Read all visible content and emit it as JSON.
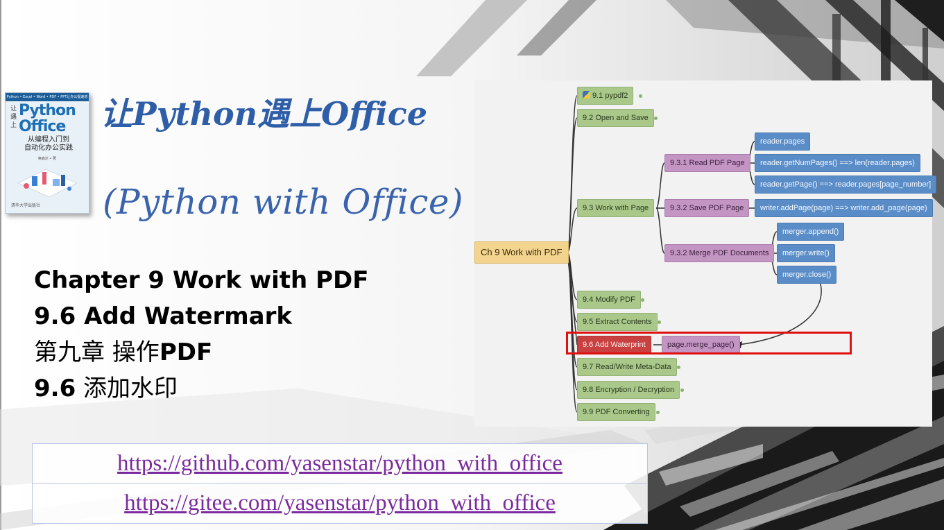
{
  "book": {
    "strip": "Python • Excel • Word • PDF • PPT让办公提速增效",
    "rang_yu_shang": "让 遇 上",
    "title_line1": "Python",
    "title_line2": "Office",
    "subtitle_line1": "从编程入门到",
    "subtitle_line2": "自动化办公实践",
    "author": "奥森达 • 著",
    "publisher": "清华大学出版社"
  },
  "title": {
    "chinese": "让Python遇上Office",
    "english": "(Python with Office)"
  },
  "chapter": {
    "line1": "Chapter 9 Work with PDF",
    "line2": "9.6 Add Watermark",
    "line3_cn": "第九章 操作",
    "line3_pdf": "PDF",
    "line4_num": "9.6",
    "line4_cn": "添加水印"
  },
  "mindmap": {
    "root": "Ch 9 Work with PDF",
    "n91": "9.1 pypdf2",
    "n92": "9.2 Open and Save",
    "n93": "9.3 Work with Page",
    "n931": "9.3.1 Read PDF Page",
    "n932a": "9.3.2 Save PDF Page",
    "n932b": "9.3.2 Merge PDF Documents",
    "reader_pages": "reader.pages",
    "reader_num": "reader.getNumPages() ==> len(reader.pages)",
    "reader_get": "reader.getPage() ==> reader.pages[page_number]",
    "writer_add": "writer.addPage(page) ==> writer.add_page(page)",
    "merger_append": "merger.append()",
    "merger_write": "merger.write()",
    "merger_close": "merger.close()",
    "n94": "9.4 Modify PDF",
    "n95": "9.5 Extract Contents",
    "n96": "9.6 Add Waterprint",
    "merge_page": "page.merge_page()",
    "n97": "9.7 Read/Write Meta-Data",
    "n98": "9.8 Encryption / Decryption",
    "n99": "9.9 PDF Converting"
  },
  "links": {
    "github": "https://github.com/yasenstar/python_with_office",
    "gitee": "https://gitee.com/yasenstar/python_with_office"
  }
}
